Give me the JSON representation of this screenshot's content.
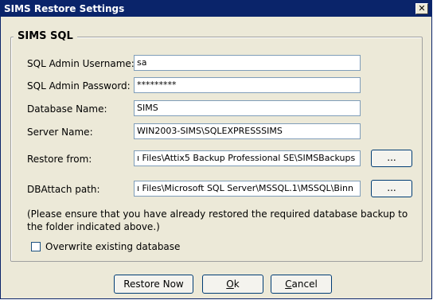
{
  "window": {
    "title": "SIMS Restore Settings",
    "close_glyph": "✕"
  },
  "group": {
    "title": "SIMS SQL"
  },
  "fields": {
    "admin_username": {
      "label": "SQL Admin Username:",
      "value": "sa"
    },
    "admin_password": {
      "label": "SQL Admin Password:",
      "value": "*********"
    },
    "database_name": {
      "label": "Database Name:",
      "value": "SIMS"
    },
    "server_name": {
      "label": "Server Name:",
      "value": "WIN2003-SIMS\\SQLEXPRESSSIMS"
    },
    "restore_from": {
      "label": "Restore from:",
      "value": "ı Files\\Attix5 Backup Professional SE\\SIMSBackups",
      "browse_label": "..."
    },
    "dbattach_path": {
      "label": "DBAttach path:",
      "value": "ı Files\\Microsoft SQL Server\\MSSQL.1\\MSSQL\\Binn",
      "browse_label": "..."
    }
  },
  "note": "(Please ensure that you have already restored the required database backup to the folder indicated above.)",
  "overwrite": {
    "label": "Overwrite existing database",
    "checked": false
  },
  "buttons": {
    "restore_now": "Restore Now",
    "ok_mnemonic": "O",
    "ok_rest": "k",
    "cancel_mnemonic": "C",
    "cancel_rest": "ancel"
  }
}
